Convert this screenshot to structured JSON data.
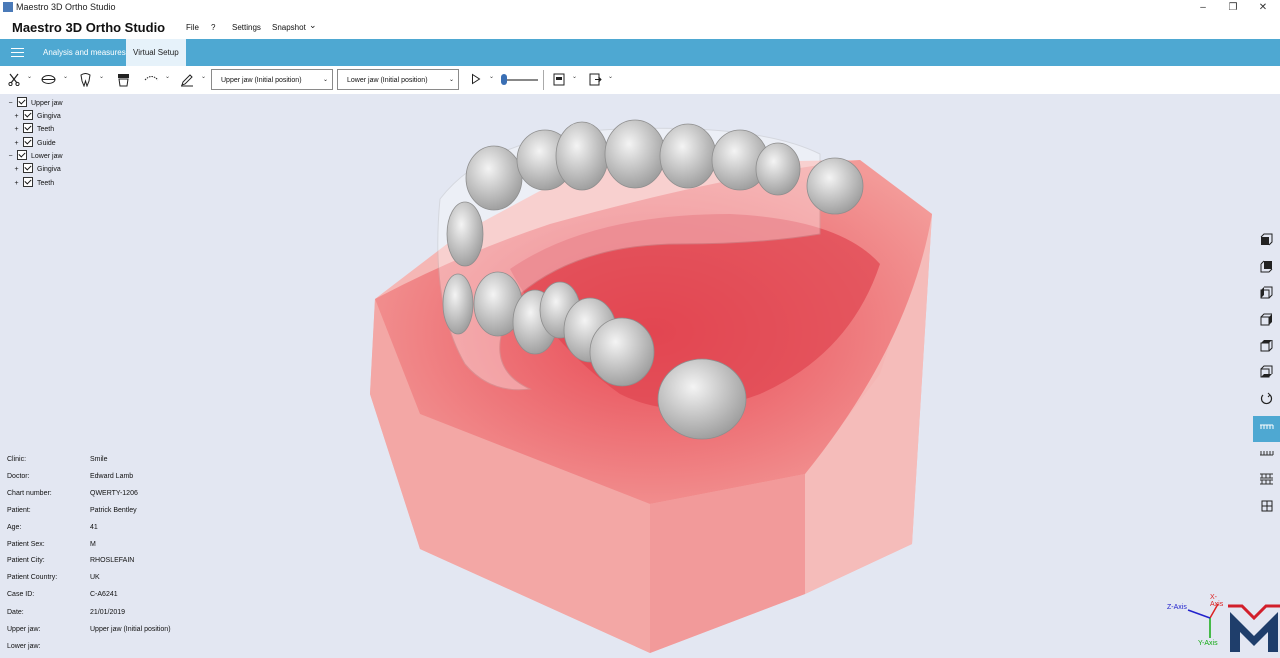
{
  "window": {
    "title": "Maestro 3D Ortho Studio",
    "minimize": "–",
    "restore": "❐",
    "close": "✕"
  },
  "menubar": {
    "brand": "Maestro 3D Ortho Studio",
    "items": [
      "File",
      "?",
      "Settings",
      "Snapshot"
    ],
    "snapshot_caret": "⌄"
  },
  "ribbon": {
    "tabs": [
      {
        "label": "Analysis and measures"
      },
      {
        "label": "Virtual Setup"
      }
    ],
    "active_tab": "Virtual Setup"
  },
  "toolbar": {
    "icons": [
      "scissors-icon",
      "jaw-icon",
      "tooth-icon",
      "aligner-icon",
      "arch-icon",
      "pen-icon",
      "play-icon",
      "export-pdf-icon",
      "export-icon"
    ],
    "upper_select": "Upper jaw (Initial position)",
    "lower_select": "Lower jaw (Initial position)",
    "slider_value": 0,
    "caret": "⌄"
  },
  "tree": {
    "items": [
      {
        "pm": "−",
        "label": "Upper jaw",
        "checked": true
      },
      {
        "pm": "+",
        "label": "Gingiva",
        "checked": true
      },
      {
        "pm": "+",
        "label": "Teeth",
        "checked": true
      },
      {
        "pm": "+",
        "label": "Guide",
        "checked": true
      },
      {
        "pm": "−",
        "label": "Lower jaw",
        "checked": true
      },
      {
        "pm": "+",
        "label": "Gingiva",
        "checked": true
      },
      {
        "pm": "+",
        "label": "Teeth",
        "checked": true
      }
    ]
  },
  "patient_info": [
    {
      "k": "Clinic:",
      "v": "Smile"
    },
    {
      "k": "Doctor:",
      "v": "Edward Lamb"
    },
    {
      "k": "Chart number:",
      "v": "QWERTY-1206"
    },
    {
      "k": "Patient:",
      "v": "Patrick Bentley"
    },
    {
      "k": "Age:",
      "v": "41"
    },
    {
      "k": "Patient Sex:",
      "v": "M"
    },
    {
      "k": "Patient City:",
      "v": "RHOSLEFAIN"
    },
    {
      "k": "Patient Country:",
      "v": "UK"
    },
    {
      "k": "Case  ID:",
      "v": "C-A6241"
    },
    {
      "k": "Date:",
      "v": "21/01/2019"
    },
    {
      "k": "Upper jaw:",
      "v": "Upper jaw (Initial position)"
    },
    {
      "k": "Lower jaw:",
      "v": ""
    }
  ],
  "axes": {
    "x": "X-Axis",
    "y": "Y-Axis",
    "z": "Z-Axis"
  },
  "view_buttons": [
    "view-front-icon",
    "view-back-icon",
    "view-left-icon",
    "view-right-icon",
    "view-top-icon",
    "view-bottom-icon",
    "rotate-icon",
    "upper-jaw-view-icon",
    "lower-jaw-view-icon",
    "both-jaws-view-icon",
    "grid-icon"
  ],
  "colors": {
    "ribbon": "#4ea8d2",
    "viewport_bg": "#e3e7f2",
    "gingiva": "#f0696c"
  }
}
